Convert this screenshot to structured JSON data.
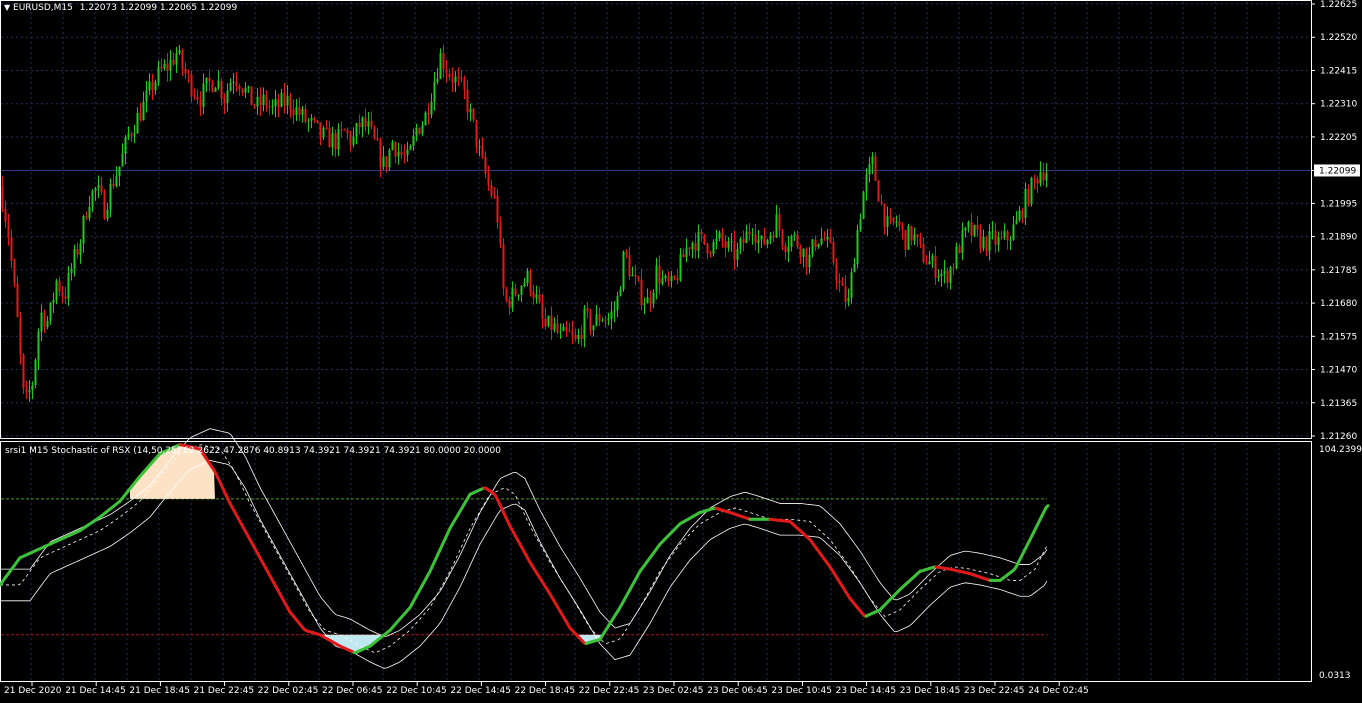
{
  "main_chart": {
    "symbol_header": "EURUSD,M15",
    "ohlc_header": "1.22073 1.22099 1.22065 1.22099",
    "menu_icon": "triangle-down-icon",
    "current_price_label": "1.22099",
    "colors": {
      "background": "#000000",
      "grid": "#1f2f5a",
      "bull": "#22c81e",
      "bear": "#e11a1a",
      "price_line": "#2f3a8a",
      "axis": "#ffffff"
    },
    "price_ticks": [
      "1.22625",
      "1.22520",
      "1.22415",
      "1.22310",
      "1.22205",
      "1.22099",
      "1.21995",
      "1.21890",
      "1.21785",
      "1.21680",
      "1.21575",
      "1.21470",
      "1.21365",
      "1.21260"
    ]
  },
  "indicator": {
    "header": "srsi1 M15 Stochastic of RSX (14,50,25) 62.2622 47.2876 40.8913 74.3921 74.3921 74.3921 80.0000 20.0000",
    "scale_top": "104.2399",
    "scale_bottom": "0.0313",
    "levels": {
      "upper": 80,
      "lower": 20
    },
    "colors": {
      "up": "#3dc23a",
      "down": "#e01a1a",
      "upper_level": "#4f9a2a",
      "lower_level": "#b01414",
      "overbought_fill": "#fde2c6",
      "oversold_fill": "#bfe9ee",
      "bands": "#ffffff"
    }
  },
  "time_axis": [
    "21 Dec 2020",
    "21 Dec 14:45",
    "21 Dec 18:45",
    "21 Dec 22:45",
    "22 Dec 02:45",
    "22 Dec 06:45",
    "22 Dec 10:45",
    "22 Dec 14:45",
    "22 Dec 18:45",
    "22 Dec 22:45",
    "23 Dec 02:45",
    "23 Dec 06:45",
    "23 Dec 10:45",
    "23 Dec 14:45",
    "23 Dec 18:45",
    "23 Dec 22:45",
    "24 Dec 02:45"
  ],
  "chart_data": {
    "type": "candlestick",
    "symbol": "EURUSD",
    "timeframe": "M15",
    "price_range": [
      1.2126,
      1.22625
    ],
    "close_path": [
      [
        0,
        1.2205
      ],
      [
        8,
        1.219
      ],
      [
        16,
        1.2166
      ],
      [
        24,
        1.2135
      ],
      [
        32,
        1.2143
      ],
      [
        40,
        1.2165
      ],
      [
        48,
        1.2162
      ],
      [
        56,
        1.2175
      ],
      [
        64,
        1.217
      ],
      [
        72,
        1.218
      ],
      [
        80,
        1.2188
      ],
      [
        88,
        1.2201
      ],
      [
        96,
        1.2204
      ],
      [
        104,
        1.2198
      ],
      [
        112,
        1.2206
      ],
      [
        120,
        1.2212
      ],
      [
        128,
        1.2221
      ],
      [
        136,
        1.2226
      ],
      [
        144,
        1.2231
      ],
      [
        152,
        1.2237
      ],
      [
        160,
        1.2241
      ],
      [
        168,
        1.2243
      ],
      [
        176,
        1.2247
      ],
      [
        184,
        1.2241
      ],
      [
        192,
        1.2236
      ],
      [
        200,
        1.2233
      ],
      [
        208,
        1.2237
      ],
      [
        216,
        1.2239
      ],
      [
        224,
        1.2233
      ],
      [
        232,
        1.224
      ],
      [
        240,
        1.2238
      ],
      [
        248,
        1.2233
      ],
      [
        256,
        1.223
      ],
      [
        264,
        1.2232
      ],
      [
        272,
        1.2229
      ],
      [
        280,
        1.2231
      ],
      [
        288,
        1.2232
      ],
      [
        296,
        1.2229
      ],
      [
        304,
        1.2226
      ],
      [
        312,
        1.2224
      ],
      [
        320,
        1.2221
      ],
      [
        328,
        1.222
      ],
      [
        336,
        1.2219
      ],
      [
        344,
        1.2222
      ],
      [
        352,
        1.2219
      ],
      [
        360,
        1.2225
      ],
      [
        368,
        1.2223
      ],
      [
        376,
        1.2217
      ],
      [
        384,
        1.2211
      ],
      [
        392,
        1.2219
      ],
      [
        400,
        1.2215
      ],
      [
        408,
        1.2213
      ],
      [
        416,
        1.2223
      ],
      [
        424,
        1.2226
      ],
      [
        432,
        1.2236
      ],
      [
        440,
        1.2246
      ],
      [
        448,
        1.2241
      ],
      [
        456,
        1.2238
      ],
      [
        464,
        1.2234
      ],
      [
        472,
        1.2225
      ],
      [
        480,
        1.2214
      ],
      [
        488,
        1.2205
      ],
      [
        496,
        1.2199
      ],
      [
        504,
        1.2168
      ],
      [
        512,
        1.217
      ],
      [
        520,
        1.2174
      ],
      [
        528,
        1.2176
      ],
      [
        536,
        1.2169
      ],
      [
        544,
        1.216
      ],
      [
        552,
        1.2161
      ],
      [
        560,
        1.2157
      ],
      [
        568,
        1.2158
      ],
      [
        576,
        1.2155
      ],
      [
        584,
        1.2163
      ],
      [
        592,
        1.2161
      ],
      [
        600,
        1.2164
      ],
      [
        608,
        1.2163
      ],
      [
        616,
        1.2167
      ],
      [
        624,
        1.2184
      ],
      [
        632,
        1.2176
      ],
      [
        640,
        1.2171
      ],
      [
        648,
        1.2168
      ],
      [
        656,
        1.2178
      ],
      [
        664,
        1.2174
      ],
      [
        672,
        1.2173
      ],
      [
        680,
        1.218
      ],
      [
        688,
        1.2187
      ],
      [
        696,
        1.2188
      ],
      [
        704,
        1.2187
      ],
      [
        712,
        1.2186
      ],
      [
        720,
        1.2188
      ],
      [
        728,
        1.2185
      ],
      [
        736,
        1.2183
      ],
      [
        744,
        1.2188
      ],
      [
        752,
        1.2193
      ],
      [
        760,
        1.2186
      ],
      [
        768,
        1.2189
      ],
      [
        776,
        1.2194
      ],
      [
        784,
        1.2187
      ],
      [
        792,
        1.2189
      ],
      [
        800,
        1.2186
      ],
      [
        808,
        1.2181
      ],
      [
        816,
        1.2189
      ],
      [
        824,
        1.2188
      ],
      [
        832,
        1.2183
      ],
      [
        840,
        1.2172
      ],
      [
        848,
        1.2168
      ],
      [
        856,
        1.2189
      ],
      [
        864,
        1.2205
      ],
      [
        872,
        1.2212
      ],
      [
        880,
        1.22
      ],
      [
        888,
        1.2191
      ],
      [
        896,
        1.2194
      ],
      [
        904,
        1.2188
      ],
      [
        912,
        1.219
      ],
      [
        920,
        1.2184
      ],
      [
        928,
        1.2181
      ],
      [
        936,
        1.2179
      ],
      [
        944,
        1.2176
      ],
      [
        952,
        1.218
      ],
      [
        960,
        1.2187
      ],
      [
        968,
        1.2191
      ],
      [
        976,
        1.2189
      ],
      [
        984,
        1.2187
      ],
      [
        992,
        1.2188
      ],
      [
        1000,
        1.2187
      ],
      [
        1008,
        1.2189
      ],
      [
        1016,
        1.2193
      ],
      [
        1024,
        1.22
      ],
      [
        1032,
        1.2205
      ],
      [
        1040,
        1.221
      ],
      [
        1046,
        1.22099
      ]
    ],
    "stochastic_rsx": {
      "params": "(14,50,25)",
      "values": [
        62.2622,
        47.2876,
        40.8913,
        74.3921,
        74.3921,
        74.3921
      ],
      "levels": [
        80,
        20
      ],
      "range": [
        0.0313,
        104.2399
      ],
      "main_line": [
        [
          0,
          42
        ],
        [
          20,
          54
        ],
        [
          40,
          58
        ],
        [
          60,
          62
        ],
        [
          80,
          66
        ],
        [
          100,
          72
        ],
        [
          120,
          79
        ],
        [
          140,
          90
        ],
        [
          160,
          100
        ],
        [
          180,
          104
        ],
        [
          200,
          102
        ],
        [
          215,
          92
        ],
        [
          230,
          78
        ],
        [
          250,
          62
        ],
        [
          270,
          46
        ],
        [
          290,
          30
        ],
        [
          305,
          22
        ],
        [
          320,
          20
        ],
        [
          340,
          15
        ],
        [
          355,
          12
        ],
        [
          370,
          15
        ],
        [
          390,
          22
        ],
        [
          410,
          32
        ],
        [
          430,
          48
        ],
        [
          450,
          67
        ],
        [
          470,
          82
        ],
        [
          485,
          85
        ],
        [
          495,
          82
        ],
        [
          510,
          68
        ],
        [
          530,
          52
        ],
        [
          550,
          38
        ],
        [
          570,
          23
        ],
        [
          585,
          16
        ],
        [
          600,
          18
        ],
        [
          620,
          32
        ],
        [
          640,
          48
        ],
        [
          660,
          60
        ],
        [
          680,
          69
        ],
        [
          700,
          74
        ],
        [
          715,
          76
        ],
        [
          730,
          74
        ],
        [
          750,
          71
        ],
        [
          770,
          71
        ],
        [
          790,
          70
        ],
        [
          810,
          62
        ],
        [
          830,
          50
        ],
        [
          850,
          36
        ],
        [
          865,
          28
        ],
        [
          880,
          31
        ],
        [
          900,
          40
        ],
        [
          920,
          48
        ],
        [
          935,
          50
        ],
        [
          950,
          49
        ],
        [
          970,
          47
        ],
        [
          990,
          44
        ],
        [
          1000,
          44
        ],
        [
          1015,
          49
        ],
        [
          1030,
          62
        ],
        [
          1047,
          77
        ]
      ]
    }
  }
}
